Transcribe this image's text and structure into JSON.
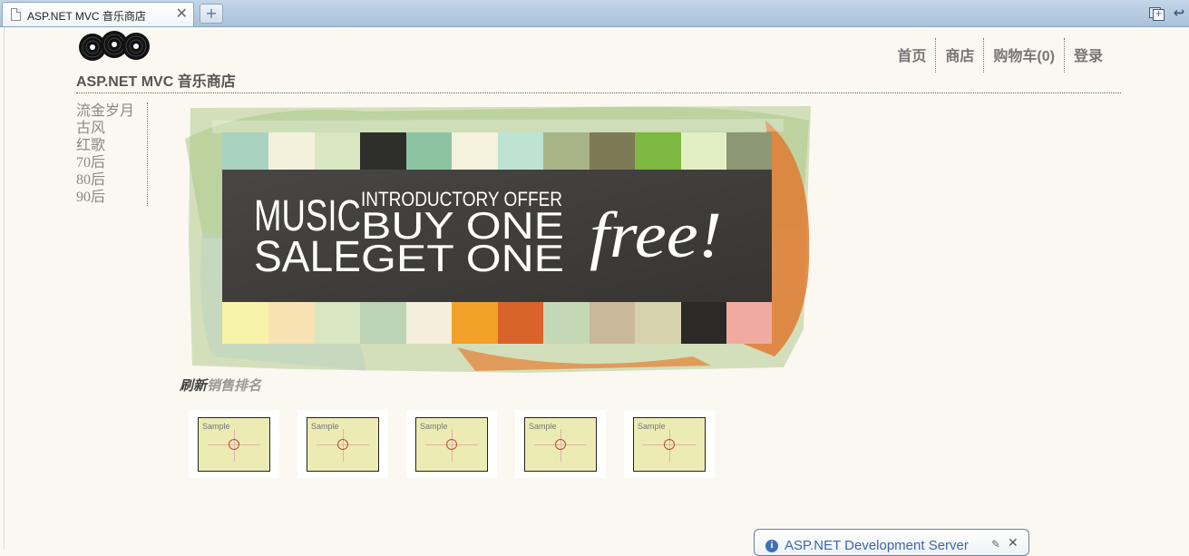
{
  "browser": {
    "tab_title": "ASP.NET MVC 音乐商店",
    "tab_close": "✕",
    "new_tab": "+",
    "icons": [
      "page-icon",
      "close-icon",
      "new-tab-icon",
      "tabs-icon",
      "back-icon"
    ]
  },
  "site": {
    "title": "ASP.NET MVC 音乐商店",
    "logo_icon": "records-logo-icon"
  },
  "nav": {
    "items": [
      "首页",
      "商店",
      "购物车(0)",
      "登录"
    ]
  },
  "sidebar": {
    "categories": [
      "流金岁月",
      "古风",
      "红歌",
      "70后",
      "80后",
      "90后"
    ]
  },
  "banner": {
    "line1_left": "MUSIC",
    "line2_left": "SALE",
    "line1_top": "INTRODUCTORY OFFER",
    "line1_right": "BUY ONE",
    "line2_right": "GET ONE",
    "script": "free!"
  },
  "bestseller": {
    "refresh_label": "刷新",
    "ranking_label": "销售排名"
  },
  "albums": [
    {
      "label": "Sample"
    },
    {
      "label": "Sample"
    },
    {
      "label": "Sample"
    },
    {
      "label": "Sample"
    },
    {
      "label": "Sample"
    }
  ],
  "notification": {
    "text": "ASP.NET Development Server",
    "info_icon": "i",
    "close": "✕",
    "wrench_icon": "🔧"
  },
  "colors": {
    "page_bg": "#faf8f0",
    "banner_dark": "#3f3d3a",
    "nav_text": "#777777",
    "link_blue": "#3a67a8"
  }
}
